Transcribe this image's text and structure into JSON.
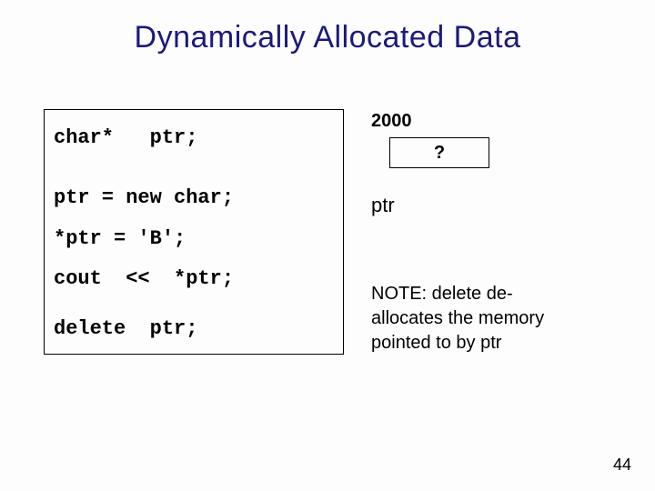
{
  "title": "Dynamically Allocated Data",
  "code": {
    "line1": "char*   ptr;",
    "line2": "ptr = new char;",
    "line3": "*ptr = 'B';",
    "line4": "cout  <<  *ptr;",
    "line5": "delete  ptr;"
  },
  "memory": {
    "address": "2000",
    "value": "?",
    "varname": "ptr"
  },
  "note_prefix": "NOTE:  delete  de-",
  "note_rest": "allocates the memory pointed to by ptr",
  "page_number": "44"
}
